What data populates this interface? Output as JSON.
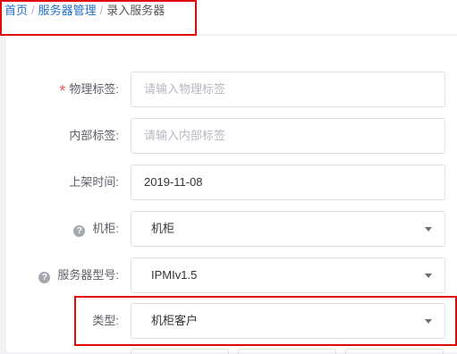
{
  "breadcrumb": {
    "items": [
      "首页",
      "服务器管理"
    ],
    "separator": "/",
    "current": "录入服务器"
  },
  "form": {
    "physical_tag": {
      "label": "物理标签:",
      "required_mark": "*",
      "placeholder": "请输入物理标签"
    },
    "internal_tag": {
      "label": "内部标签:",
      "placeholder": "请输入内部标签"
    },
    "shelf_time": {
      "label": "上架时间:",
      "value": "2019-11-08"
    },
    "cabinet": {
      "label": "机柜:",
      "help_glyph": "?",
      "value": "机柜"
    },
    "server_model": {
      "label": "服务器型号:",
      "help_glyph": "?",
      "value": "IPMIv1.5"
    },
    "type": {
      "label": "类型:",
      "value": "机柜客户"
    }
  },
  "colors": {
    "link": "#1f6fc5",
    "required": "#f25555",
    "annotation": "#e00a0a",
    "border": "#dcdfe6"
  }
}
